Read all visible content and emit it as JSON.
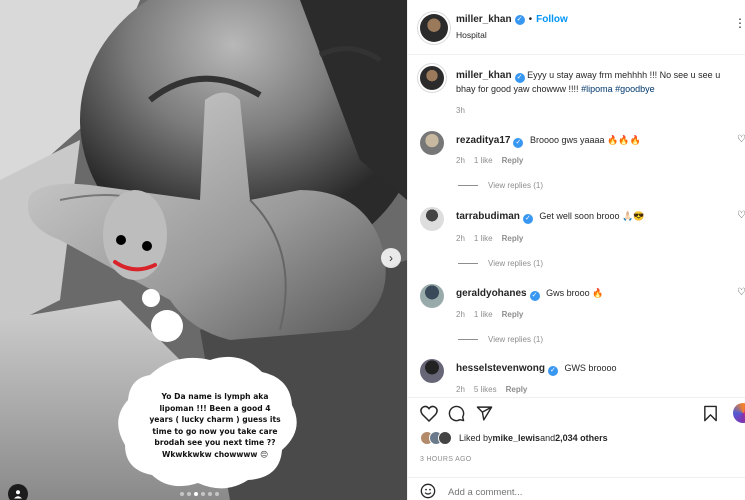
{
  "post": {
    "slide_dots": 6,
    "active_dot": 3,
    "bubble_text": "Yo Da name is lymph aka lipoman !!! Been a good 4 years ( lucky charm ) guess its time to go now you take care brodah see you next time ?? Wkwkkwkw chowwww 😔"
  },
  "header": {
    "username": "miller_khan",
    "verified": true,
    "separator": "•",
    "follow_label": "Follow",
    "location": "Hospital",
    "more_label": "⋯"
  },
  "caption": {
    "username": "miller_khan",
    "text": "Eyyy u stay away frm mehhhh !!! No see u see u bhay for good yaw chowww !!!! ",
    "hashtags": "#lipoma #goodbye",
    "time": "3h"
  },
  "comments": [
    {
      "username": "rezaditya17",
      "text": "Broooo gws yaaaa 🔥🔥🔥",
      "time": "2h",
      "likes": "1 like",
      "reply_label": "Reply",
      "view_replies": "View replies (1)"
    },
    {
      "username": "tarrabudiman",
      "text": "Get well soon brooo 🙏🏻😎",
      "time": "2h",
      "likes": "1 like",
      "reply_label": "Reply",
      "view_replies": "View replies (1)"
    },
    {
      "username": "geraldyohanes",
      "text": "Gws brooo 🔥",
      "time": "2h",
      "likes": "1 like",
      "reply_label": "Reply",
      "view_replies": "View replies (1)"
    },
    {
      "username": "hesselstevenwong",
      "text": "GWS broooo",
      "time": "2h",
      "likes": "5 likes",
      "reply_label": "Reply",
      "view_replies": ""
    }
  ],
  "likes": {
    "prefix": "Liked by ",
    "user": "mike_lewis",
    "middle": " and ",
    "count": "2,034 others"
  },
  "timeago": "3 HOURS AGO",
  "add_comment": {
    "placeholder": "Add a comment..."
  },
  "colors": {
    "accent": "#0095f6",
    "verified": "#3897f0",
    "hashtag": "#00376b",
    "muted": "#8e8e8e"
  },
  "icons": [
    "heart-icon",
    "comment-icon",
    "share-icon",
    "bookmark-icon",
    "emoji-icon",
    "more-icon",
    "next-arrow-icon",
    "verified-badge-icon"
  ]
}
